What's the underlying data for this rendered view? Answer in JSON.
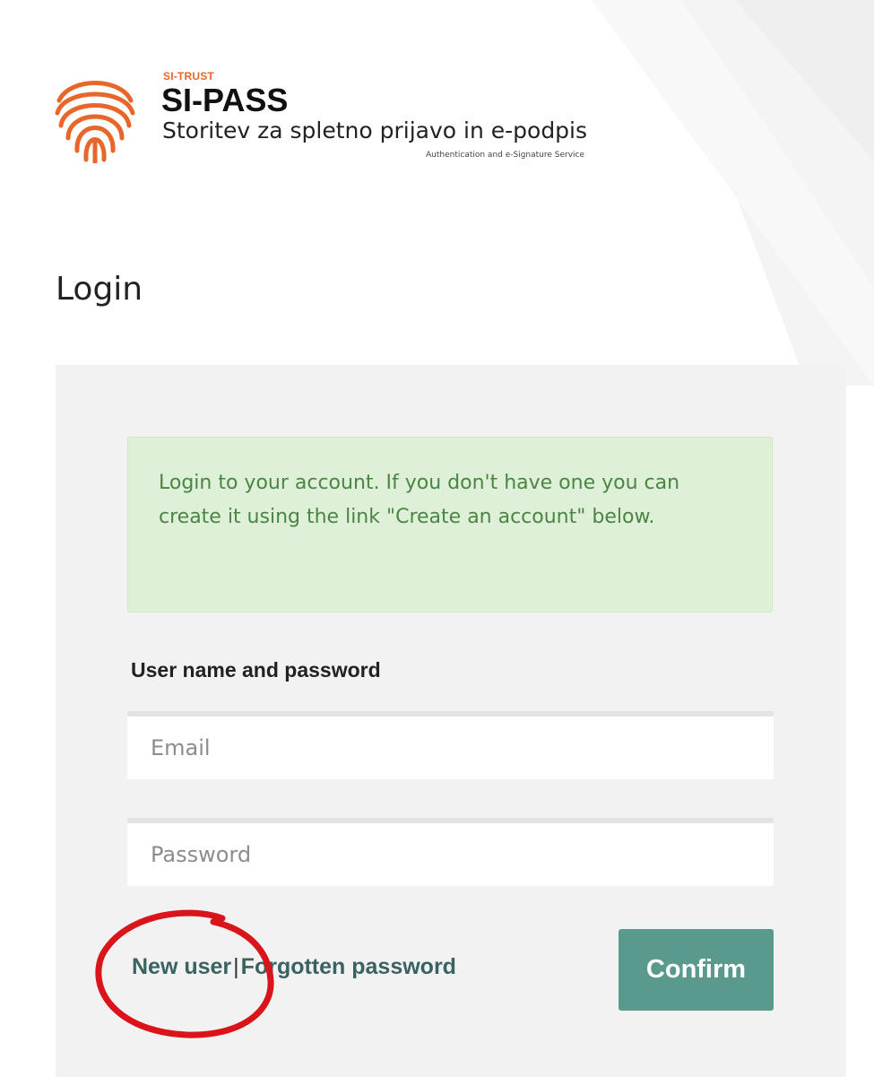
{
  "brand": {
    "org": "SI-TRUST",
    "name": "SI-PASS",
    "subtitle": "Storitev za spletno prijavo in e-podpis",
    "subtitle_en": "Authentication and e-Signature Service"
  },
  "page": {
    "title": "Login"
  },
  "form": {
    "info_message": "Login to your account. If you don't have one you can create it using the link \"Create an account\" below.",
    "section_label": "User name and password",
    "email": {
      "value": "",
      "placeholder": "Email"
    },
    "password": {
      "value": "",
      "placeholder": "Password"
    },
    "new_user_label": "New user",
    "separator": "|",
    "forgotten_password_label": "Forgotten password",
    "confirm_label": "Confirm"
  },
  "colors": {
    "brand_orange": "#e8662a",
    "info_background": "#dff0d8",
    "info_text": "#4a8544",
    "link": "#3a6260",
    "confirm_button": "#5a9a8c",
    "panel_background": "#f2f2f2",
    "annotation_circle": "#d9141b"
  },
  "icons": {
    "logo": "fingerprint-icon"
  }
}
